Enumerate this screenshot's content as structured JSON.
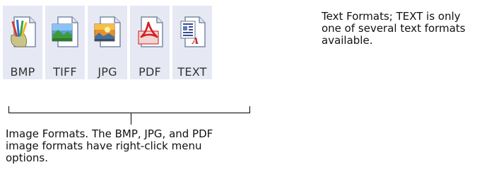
{
  "format_buttons": [
    {
      "label": "BMP",
      "icon": "bmp-paint-icon"
    },
    {
      "label": "TIFF",
      "icon": "tiff-landscape-icon"
    },
    {
      "label": "JPG",
      "icon": "jpg-photo-icon"
    },
    {
      "label": "PDF",
      "icon": "pdf-acrobat-icon"
    },
    {
      "label": "TEXT",
      "icon": "text-document-icon"
    }
  ],
  "captions": {
    "text_formats": "Text Formats; TEXT is only one of several text formats available.",
    "image_formats": "Image Formats. The BMP, JPG, and PDF image formats have right-click menu options."
  },
  "colors": {
    "tile_background": "#e6e9f4",
    "label_text": "#333333",
    "caption_text": "#111111"
  }
}
